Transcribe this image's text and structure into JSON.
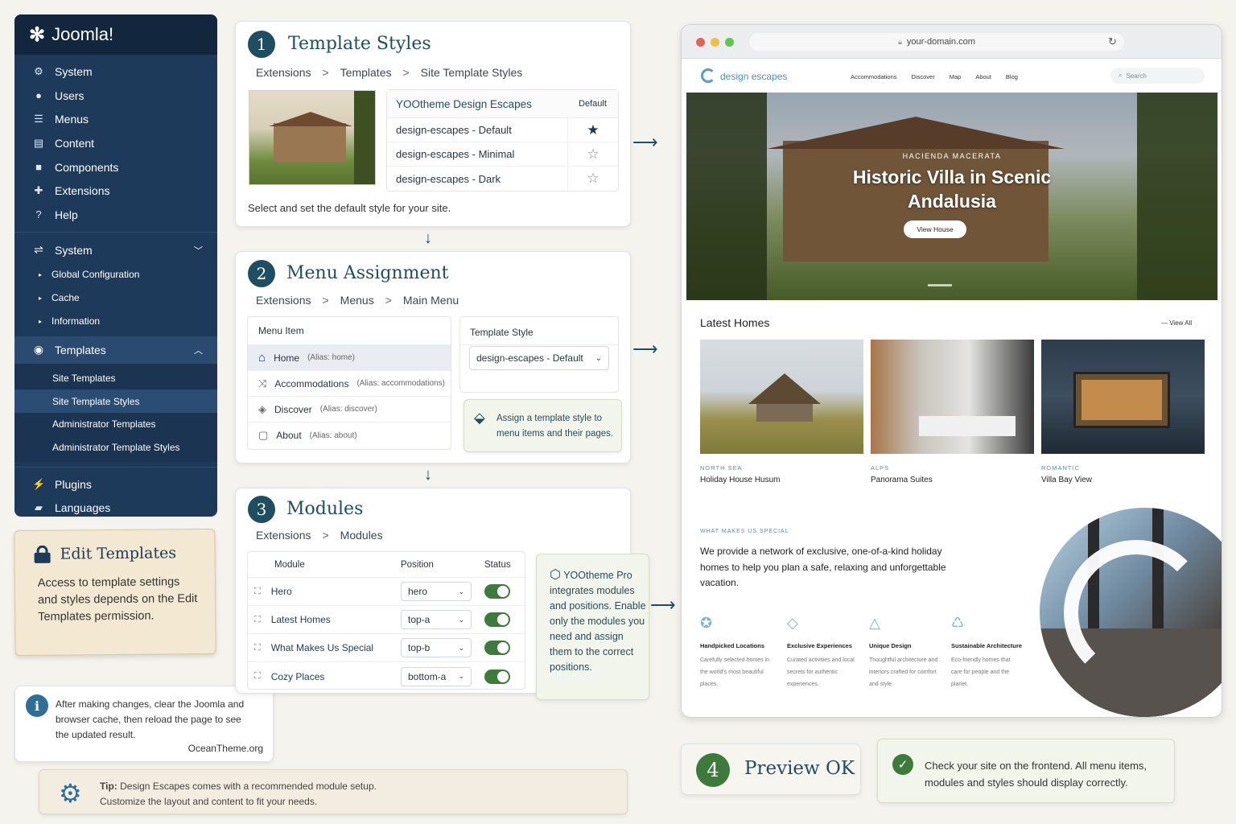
{
  "sidebar": {
    "brand": "Joomla!",
    "top_items": [
      {
        "icon": "gear-icon",
        "label": "System"
      },
      {
        "icon": "user-icon",
        "label": "Users"
      },
      {
        "icon": "list-icon",
        "label": "Menus"
      },
      {
        "icon": "file-icon",
        "label": "Content"
      },
      {
        "icon": "cube-icon",
        "label": "Components"
      },
      {
        "icon": "puzzle-icon",
        "label": "Extensions"
      },
      {
        "icon": "help-icon",
        "label": "Help"
      }
    ],
    "system_section": {
      "label": "System",
      "items": [
        "Global Configuration",
        "Cache",
        "Information"
      ]
    },
    "templates_section": {
      "label": "Templates",
      "items": [
        "Site Templates",
        "Site Template Styles",
        "Administrator Templates",
        "Administrator Template Styles"
      ],
      "active": "Site Template Styles"
    },
    "bottom_items": [
      {
        "icon": "plug-icon",
        "label": "Plugins"
      },
      {
        "icon": "comments-icon",
        "label": "Languages"
      }
    ]
  },
  "edit_note": {
    "title": "Edit Templates",
    "text": "Access to template settings and styles depends on the Edit Templates permission."
  },
  "info_note": {
    "text": "After making changes, clear the Joomla and browser cache, then reload the page to see the updated result.",
    "credit": "OceanTheme.org"
  },
  "tip": {
    "label": "Tip:",
    "text_line1": "Design Escapes comes with a recommended module setup.",
    "text_line2": "Customize the layout and content to fit your needs."
  },
  "step1": {
    "num": "1",
    "title": "Template Styles",
    "crumbs": [
      "Extensions",
      "Templates",
      "Site Template Styles"
    ],
    "header_name": "YOOtheme Design Escapes",
    "header_default": "Default",
    "styles": [
      {
        "name": "design-escapes - Default",
        "default": true
      },
      {
        "name": "design-escapes - Minimal",
        "default": false
      },
      {
        "name": "design-escapes - Dark",
        "default": false
      }
    ],
    "caption": "Select and set the default style for your site."
  },
  "step2": {
    "num": "2",
    "title": "Menu Assignment",
    "crumbs": [
      "Extensions",
      "Menus",
      "Main Menu"
    ],
    "col_menu": "Menu Item",
    "col_style": "Template Style",
    "items": [
      {
        "icon": "home-icon",
        "name": "Home",
        "alias": "(Alias: home)"
      },
      {
        "icon": "shuffle-icon",
        "name": "Accommodations",
        "alias": "(Alias: accommodations)"
      },
      {
        "icon": "compass-icon",
        "name": "Discover",
        "alias": "(Alias: discover)"
      },
      {
        "icon": "about-icon",
        "name": "About",
        "alias": "(Alias: about)"
      }
    ],
    "selected_style": "design-escapes - Default",
    "note": "Assign a template style to menu items and their pages."
  },
  "step3": {
    "num": "3",
    "title": "Modules",
    "crumbs": [
      "Extensions",
      "Modules"
    ],
    "cols": [
      "Module",
      "Position",
      "Status"
    ],
    "modules": [
      {
        "name": "Hero",
        "position": "hero",
        "enabled": true
      },
      {
        "name": "Latest Homes",
        "position": "top-a",
        "enabled": true
      },
      {
        "name": "What Makes Us Special",
        "position": "top-b",
        "enabled": true
      },
      {
        "name": "Cozy Places",
        "position": "bottom-a",
        "enabled": true
      }
    ],
    "note": "YOOtheme Pro integrates modules and positions. Enable only the modules you need and assign them to the correct positions."
  },
  "browser": {
    "url": "your-domain.com",
    "logo": "design escapes",
    "nav": [
      "Accommodations",
      "Discover",
      "Map",
      "About",
      "Blog"
    ],
    "search_placeholder": "Search",
    "hero": {
      "kicker": "HACIENDA MACERATA",
      "title": "Historic Villa in Scenic Andalusia",
      "button": "View House"
    },
    "latest": {
      "title": "Latest Homes",
      "view_all": "View All",
      "homes": [
        {
          "tag": "NORTH SEA",
          "name": "Holiday House Husum"
        },
        {
          "tag": "ALPS",
          "name": "Panorama Suites"
        },
        {
          "tag": "ROMANTIC",
          "name": "Villa Bay View"
        }
      ]
    },
    "special": {
      "kicker": "WHAT MAKES US SPECIAL",
      "text": "We provide a network of exclusive, one-of-a-kind holiday homes to help you plan a safe, relaxing and unforgettable vacation.",
      "features": [
        {
          "title": "Handpicked Locations",
          "desc": "Carefully selected homes in the world's most beautiful places."
        },
        {
          "title": "Exclusive Experiences",
          "desc": "Curated activities and local secrets for authentic experiences."
        },
        {
          "title": "Unique Design",
          "desc": "Thoughtful architecture and interiors crafted for comfort and style."
        },
        {
          "title": "Sustainable Architecture",
          "desc": "Eco-friendly homes that care for people and the planet."
        }
      ]
    }
  },
  "step4": {
    "num": "4",
    "title": "Preview OK",
    "check_text": "Check your site on the frontend. All menu items, modules and styles should display correctly."
  },
  "colors": {
    "sidebar": "#1e3a5b",
    "accent": "#1f4e63",
    "toggle": "#3d7a3c"
  }
}
